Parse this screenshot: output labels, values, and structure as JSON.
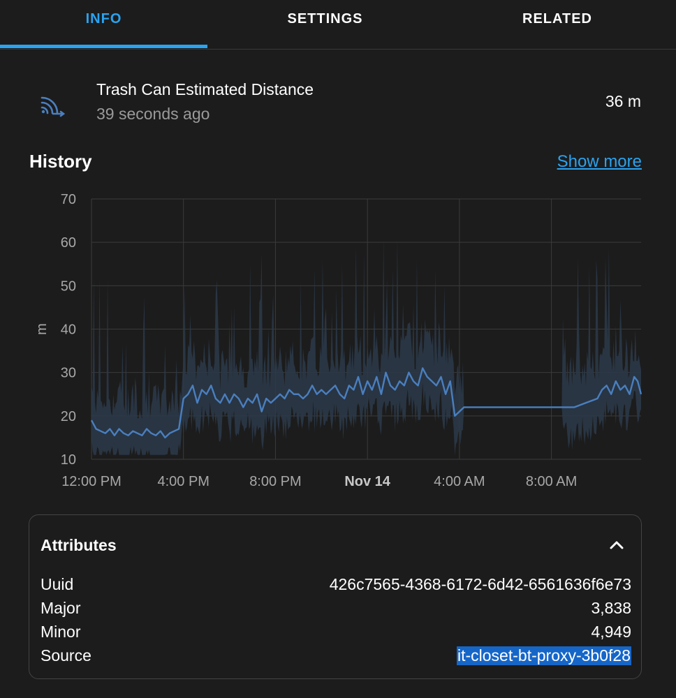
{
  "tabs": [
    {
      "label": "INFO",
      "active": true
    },
    {
      "label": "SETTINGS",
      "active": false
    },
    {
      "label": "RELATED",
      "active": false
    }
  ],
  "entity": {
    "icon": "bluetooth-connect-icon",
    "name": "Trash Can Estimated Distance",
    "last_changed": "39 seconds ago",
    "state": "36 m"
  },
  "history": {
    "title": "History",
    "show_more": "Show more"
  },
  "chart_data": {
    "type": "line",
    "ylabel": "m",
    "ylim": [
      10,
      70
    ],
    "yticks": [
      "70",
      "60",
      "50",
      "40",
      "30",
      "20",
      "10"
    ],
    "xticks": [
      "12:00 PM",
      "4:00 PM",
      "8:00 PM",
      "Nov 14",
      "4:00 AM",
      "8:00 AM"
    ],
    "x_hours_from_start": [
      0,
      4,
      8,
      12,
      16,
      20
    ],
    "x_range_hours": [
      0,
      23.9
    ],
    "grid": true,
    "line_color": "#4a7fbf",
    "band_color": "#2c3a4a",
    "series": [
      {
        "values_mean": [
          [
            0.0,
            19
          ],
          [
            0.2,
            17
          ],
          [
            0.4,
            16.5
          ],
          [
            0.6,
            16
          ],
          [
            0.8,
            17
          ],
          [
            1.0,
            15.5
          ],
          [
            1.2,
            17
          ],
          [
            1.4,
            16
          ],
          [
            1.6,
            15.5
          ],
          [
            1.8,
            16.5
          ],
          [
            2.0,
            16
          ],
          [
            2.2,
            15.5
          ],
          [
            2.4,
            17
          ],
          [
            2.6,
            16
          ],
          [
            2.8,
            15.5
          ],
          [
            3.0,
            16.5
          ],
          [
            3.2,
            15
          ],
          [
            3.4,
            16
          ],
          [
            3.6,
            16.5
          ],
          [
            3.8,
            17
          ],
          [
            4.0,
            24
          ],
          [
            4.2,
            25
          ],
          [
            4.4,
            27
          ],
          [
            4.6,
            23
          ],
          [
            4.8,
            26
          ],
          [
            5.0,
            25
          ],
          [
            5.2,
            27
          ],
          [
            5.4,
            24
          ],
          [
            5.6,
            23
          ],
          [
            5.8,
            25
          ],
          [
            6.0,
            23
          ],
          [
            6.2,
            25
          ],
          [
            6.4,
            24
          ],
          [
            6.6,
            22
          ],
          [
            6.8,
            24
          ],
          [
            7.0,
            23
          ],
          [
            7.2,
            25
          ],
          [
            7.4,
            21
          ],
          [
            7.6,
            24
          ],
          [
            7.8,
            23
          ],
          [
            8.0,
            24
          ],
          [
            8.2,
            25
          ],
          [
            8.4,
            24
          ],
          [
            8.6,
            26
          ],
          [
            8.8,
            25
          ],
          [
            9.0,
            25
          ],
          [
            9.2,
            24
          ],
          [
            9.4,
            25
          ],
          [
            9.6,
            27
          ],
          [
            9.8,
            25
          ],
          [
            10.0,
            26
          ],
          [
            10.2,
            25
          ],
          [
            10.4,
            26
          ],
          [
            10.6,
            27
          ],
          [
            10.8,
            25
          ],
          [
            11.0,
            24
          ],
          [
            11.2,
            27
          ],
          [
            11.4,
            26
          ],
          [
            11.6,
            29
          ],
          [
            11.8,
            25
          ],
          [
            12.0,
            28
          ],
          [
            12.2,
            26
          ],
          [
            12.4,
            29
          ],
          [
            12.6,
            25
          ],
          [
            12.8,
            30
          ],
          [
            13.0,
            27
          ],
          [
            13.2,
            26
          ],
          [
            13.4,
            28
          ],
          [
            13.6,
            27
          ],
          [
            13.8,
            30
          ],
          [
            14.0,
            28
          ],
          [
            14.2,
            27
          ],
          [
            14.4,
            31
          ],
          [
            14.6,
            29
          ],
          [
            14.8,
            28
          ],
          [
            15.0,
            27
          ],
          [
            15.2,
            29
          ],
          [
            15.4,
            25
          ],
          [
            15.6,
            28
          ],
          [
            15.8,
            20
          ],
          [
            16.0,
            21
          ],
          [
            16.2,
            22
          ],
          [
            16.5,
            22
          ],
          [
            17,
            22
          ],
          [
            18,
            22
          ],
          [
            19,
            22
          ],
          [
            20,
            22
          ],
          [
            20.5,
            22
          ],
          [
            21.0,
            22
          ],
          [
            21.5,
            23
          ],
          [
            22.0,
            24
          ],
          [
            22.2,
            26
          ],
          [
            22.4,
            27
          ],
          [
            22.6,
            25
          ],
          [
            22.8,
            28
          ],
          [
            23.0,
            26
          ],
          [
            23.2,
            27
          ],
          [
            23.4,
            25
          ],
          [
            23.6,
            29
          ],
          [
            23.75,
            28
          ],
          [
            23.9,
            25
          ]
        ],
        "band_min": 11,
        "band_note": ""
      }
    ]
  },
  "attributes": {
    "title": "Attributes",
    "toggle_icon": "chevron-up-icon",
    "rows": [
      {
        "key": "Uuid",
        "value": "426c7565-4368-6172-6d42-6561636f6e73",
        "selected": false
      },
      {
        "key": "Major",
        "value": "3,838",
        "selected": false
      },
      {
        "key": "Minor",
        "value": "4,949",
        "selected": false
      },
      {
        "key": "Source",
        "value": "it-closet-bt-proxy-3b0f28",
        "selected": true
      }
    ]
  }
}
